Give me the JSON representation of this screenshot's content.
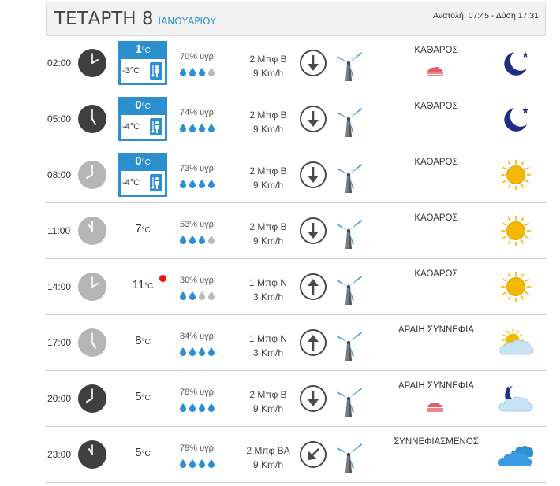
{
  "header": {
    "day": "ΤΕΤΑΡΤΗ 8",
    "month": "ΙΑΝΟΥΑΡΙΟΥ",
    "sun_times": "Ανατολή: 07:45  - Δύση 17:31"
  },
  "colors": {
    "accent": "#2b8fd0",
    "hot_marker": "#e81010",
    "moon": "#1f2f86",
    "sun": "#f5b800"
  },
  "rows": [
    {
      "time": "02:00",
      "clock": "dark",
      "tmax": "1",
      "tmin": "-3°C",
      "temp": "",
      "unit": "°C",
      "humidity": "70% υγρ.",
      "drops_filled": 3,
      "wind": "2 Μπφ Β",
      "wind_kmh": "9 Km/h",
      "direction": "down",
      "sky": "ΚΑΘΑΡΟΣ",
      "fog": true,
      "icon": "moon-icon"
    },
    {
      "time": "05:00",
      "clock": "dark",
      "tmax": "0",
      "tmin": "-4°C",
      "temp": "",
      "unit": "°C",
      "humidity": "74% υγρ.",
      "drops_filled": 4,
      "wind": "2 Μπφ Β",
      "wind_kmh": "9 Km/h",
      "direction": "down",
      "sky": "ΚΑΘΑΡΟΣ",
      "fog": false,
      "icon": "moon-icon"
    },
    {
      "time": "08:00",
      "clock": "light",
      "tmax": "0",
      "tmin": "-4°C",
      "temp": "",
      "unit": "°C",
      "humidity": "73% υγρ.",
      "drops_filled": 4,
      "wind": "2 Μπφ Β",
      "wind_kmh": "9 Km/h",
      "direction": "down",
      "sky": "ΚΑΘΑΡΟΣ",
      "fog": false,
      "icon": "sun-icon"
    },
    {
      "time": "11:00",
      "clock": "light",
      "tmax": "",
      "tmin": "",
      "temp": "7",
      "unit": "°C",
      "humidity": "53% υγρ.",
      "drops_filled": 3,
      "wind": "2 Μπφ Β",
      "wind_kmh": "9 Km/h",
      "direction": "down",
      "sky": "ΚΑΘΑΡΟΣ",
      "fog": false,
      "icon": "sun-icon"
    },
    {
      "time": "14:00",
      "clock": "light",
      "tmax": "",
      "tmin": "",
      "temp": "11",
      "unit": "°C",
      "hot": true,
      "humidity": "30% υγρ.",
      "drops_filled": 2,
      "wind": "1 Μπφ Ν",
      "wind_kmh": "3 Km/h",
      "direction": "up",
      "sky": "ΚΑΘΑΡΟΣ",
      "fog": false,
      "icon": "sun-icon"
    },
    {
      "time": "17:00",
      "clock": "light",
      "tmax": "",
      "tmin": "",
      "temp": "8",
      "unit": "°C",
      "humidity": "84% υγρ.",
      "drops_filled": 4,
      "wind": "1 Μπφ Ν",
      "wind_kmh": "3 Km/h",
      "direction": "up",
      "sky": "ΑΡΑΙΗ ΣΥΝΝΕΦΙΑ",
      "fog": false,
      "icon": "sun-cloud-icon"
    },
    {
      "time": "20:00",
      "clock": "dark",
      "tmax": "",
      "tmin": "",
      "temp": "5",
      "unit": "°C",
      "humidity": "78% υγρ.",
      "drops_filled": 4,
      "wind": "2 Μπφ Β",
      "wind_kmh": "9 Km/h",
      "direction": "down",
      "sky": "ΑΡΑΙΗ ΣΥΝΝΕΦΙΑ",
      "fog": true,
      "icon": "moon-cloud-icon"
    },
    {
      "time": "23:00",
      "clock": "dark",
      "tmax": "",
      "tmin": "",
      "temp": "5",
      "unit": "°C",
      "humidity": "79% υγρ.",
      "drops_filled": 4,
      "wind": "2 Μπφ ΒΑ",
      "wind_kmh": "9 Km/h",
      "direction": "down-left",
      "sky": "ΣΥΝΝΕΦΙΑΣΜΕΝΟΣ",
      "fog": false,
      "icon": "clouds-icon"
    }
  ]
}
